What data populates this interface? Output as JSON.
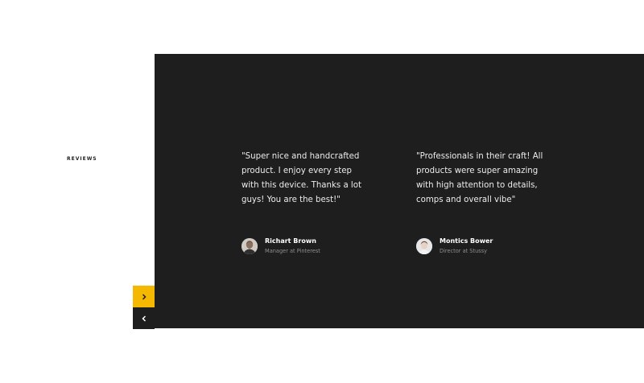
{
  "section": {
    "label": "REVIEWS"
  },
  "reviews": [
    {
      "quote": "\"Super nice and handcrafted product.  I enjoy every step with this device. Thanks a lot guys! You are the best!\"",
      "name": "Richart Brown",
      "role": "Manager at Pinterest"
    },
    {
      "quote": "\"Professionals in their craft! All products were super amazing with high attention to details, comps and overall vibe\"",
      "name": "Montics Bower",
      "role": "Director at Stussy"
    }
  ],
  "navigation": {
    "next_icon": "chevron-right-icon",
    "prev_icon": "chevron-left-icon"
  },
  "colors": {
    "panel_background": "#1e1e1e",
    "accent": "#f5b800",
    "quote_text": "#ececec",
    "role_text": "#8e8e8e"
  }
}
